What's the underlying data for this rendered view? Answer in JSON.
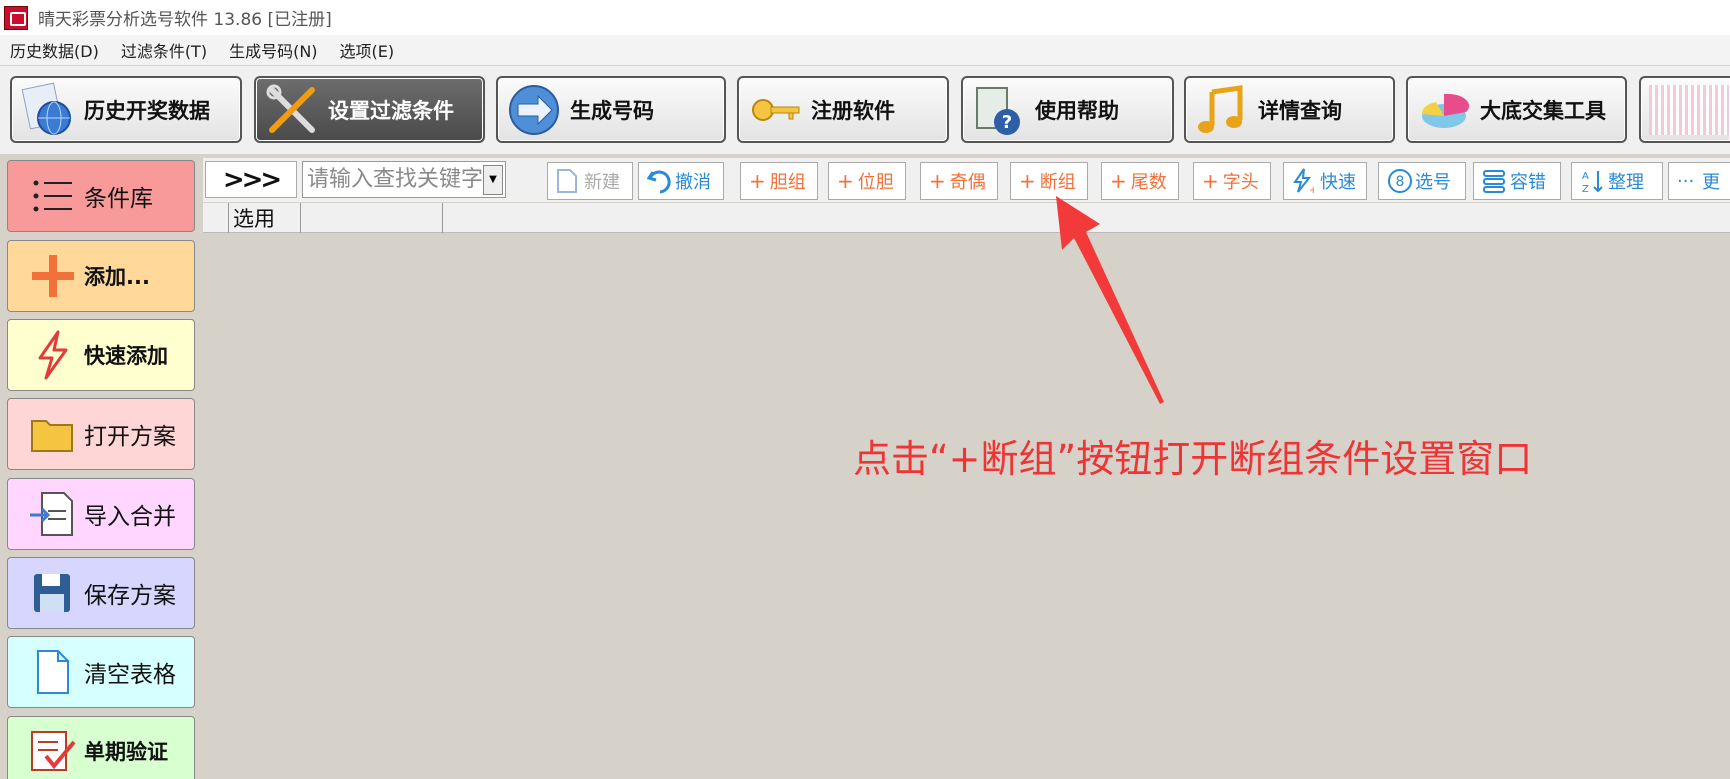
{
  "window": {
    "title": "晴天彩票分析选号软件 13.86  [已注册]"
  },
  "menu": {
    "items": [
      {
        "label": "历史数据(D)"
      },
      {
        "label": "过滤条件(T)"
      },
      {
        "label": "生成号码(N)"
      },
      {
        "label": "选项(E)"
      }
    ]
  },
  "toolbar": {
    "buttons": [
      {
        "label": "历史开奖数据",
        "icon": "globe-documents-icon"
      },
      {
        "label": "设置过滤条件",
        "icon": "tools-icon"
      },
      {
        "label": "生成号码",
        "icon": "arrow-circle-icon"
      },
      {
        "label": "注册软件",
        "icon": "key-icon"
      },
      {
        "label": "使用帮助",
        "icon": "help-book-icon"
      },
      {
        "label": "详情查询",
        "icon": "music-note-icon"
      },
      {
        "label": "大底交集工具",
        "icon": "pie-chart-icon"
      }
    ]
  },
  "sidebar": {
    "items": [
      {
        "label": "条件库",
        "color": "#f99a9a",
        "icon": "list-icon"
      },
      {
        "label": "添加...",
        "color": "#ffd89a",
        "icon": "plus-icon"
      },
      {
        "label": "快速添加",
        "color": "#ffffd0",
        "icon": "lightning-icon"
      },
      {
        "label": "打开方案",
        "color": "#ffd6d6",
        "icon": "folder-icon"
      },
      {
        "label": "导入合并",
        "color": "#ffd6ff",
        "icon": "import-icon"
      },
      {
        "label": "保存方案",
        "color": "#d6d6ff",
        "icon": "save-icon"
      },
      {
        "label": "清空表格",
        "color": "#d6ffff",
        "icon": "blank-page-icon"
      },
      {
        "label": "单期验证",
        "color": "#d8ffd0",
        "icon": "checklist-icon"
      }
    ]
  },
  "subtoolbar": {
    "arrows": ">>>",
    "search_placeholder": "请输入查找关键字",
    "buttons": [
      {
        "label": "新建",
        "prefix": ""
      },
      {
        "label": "撤消",
        "prefix": ""
      },
      {
        "label": "胆组",
        "prefix": "+"
      },
      {
        "label": "位胆",
        "prefix": "+"
      },
      {
        "label": "奇偶",
        "prefix": "+"
      },
      {
        "label": "断组",
        "prefix": "+"
      },
      {
        "label": "尾数",
        "prefix": "+"
      },
      {
        "label": "字头",
        "prefix": "+"
      },
      {
        "label": "快速",
        "prefix": ""
      },
      {
        "label": "选号",
        "prefix": ""
      },
      {
        "label": "容错",
        "prefix": ""
      },
      {
        "label": "整理",
        "prefix": ""
      },
      {
        "label": "更",
        "prefix": "···"
      }
    ]
  },
  "grid": {
    "columns": [
      "选用"
    ]
  },
  "annotation": {
    "text": "点击“+断组”按钮打开断组条件设置窗口",
    "color": "#ee3434"
  }
}
